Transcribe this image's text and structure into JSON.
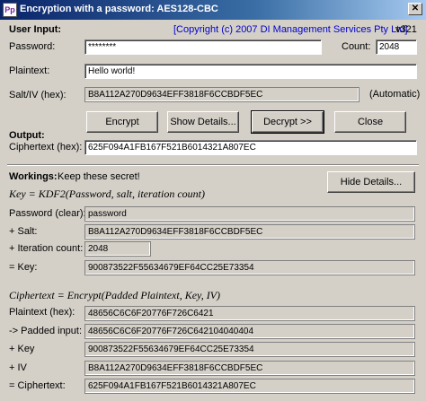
{
  "window": {
    "title": "Encryption with a password: AES128-CBC",
    "icon_text": "Pp",
    "close_glyph": "✕"
  },
  "input_section": {
    "heading": "User Input:",
    "copyright": "[Copyright (c) 2007 DI Management Services Pty Ltd]",
    "version": "v321",
    "password_label": "Password:",
    "password_value": "********",
    "count_label": "Count:",
    "count_value": "2048",
    "plaintext_label": "Plaintext:",
    "plaintext_value": "Hello world!",
    "salt_label": "Salt/IV (hex):",
    "salt_value": "B8A112A270D9634EFF3818F6CCBDF5EC",
    "automatic_label": "(Automatic)"
  },
  "buttons": {
    "encrypt": "Encrypt",
    "show_details": "Show Details...",
    "decrypt": "Decrypt >>",
    "close": "Close",
    "hide_details": "Hide Details..."
  },
  "output_section": {
    "heading": "Output:",
    "ciphertext_label": "Ciphertext (hex):",
    "ciphertext_value": "625F094A1FB167F521B6014321A807EC"
  },
  "workings": {
    "heading": "Workings:",
    "note": "Keep these secret!",
    "key_formula": "Key = KDF2(Password, salt, iteration count)",
    "password_label": "Password (clear):",
    "password_value": "password",
    "salt_label": "+ Salt:",
    "salt_value": "B8A112A270D9634EFF3818F6CCBDF5EC",
    "iter_label": "+ Iteration count:",
    "iter_value": "2048",
    "key_label": "= Key:",
    "key_value": "900873522F55634679EF64CC25E73354",
    "cipher_formula": "Ciphertext = Encrypt(Padded Plaintext, Key, IV)",
    "plain_hex_label": "Plaintext (hex):",
    "plain_hex_value": "48656C6C6F20776F726C6421",
    "padded_label": "-> Padded input:",
    "padded_value": "48656C6C6F20776F726C642104040404",
    "key2_label": "+ Key",
    "key2_value": "900873522F55634679EF64CC25E73354",
    "iv_label": "+ IV",
    "iv_value": "B8A112A270D9634EFF3818F6CCBDF5EC",
    "ct_label": "= Ciphertext:",
    "ct_value": "625F094A1FB167F521B6014321A807EC"
  }
}
